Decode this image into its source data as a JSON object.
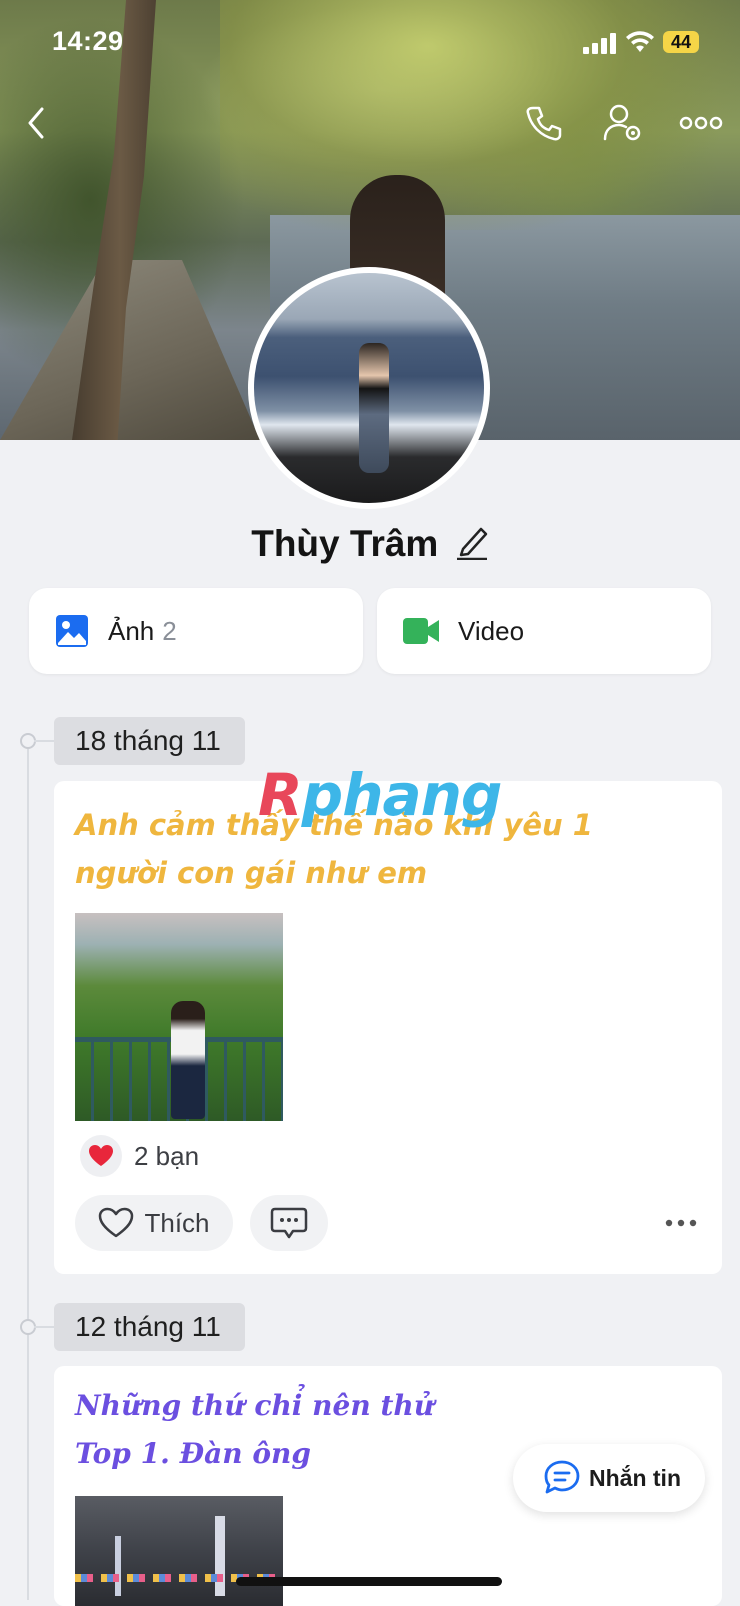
{
  "status_bar": {
    "time": "14:29",
    "battery": "44"
  },
  "profile": {
    "name": "Thùy Trâm"
  },
  "media_buttons": {
    "photos_label": "Ảnh",
    "photos_count": "2",
    "video_label": "Video"
  },
  "watermark": {
    "part1": "R",
    "part2": "phang"
  },
  "posts": [
    {
      "date": "18 tháng 11",
      "title_line1": "Anh cảm thấy thế nào khi yêu 1",
      "title_line2": "người con gái như em",
      "reactions": "2 bạn",
      "like_label": "Thích"
    },
    {
      "date": "12 tháng 11",
      "title_line1": "Những thứ chỉ nên thử",
      "title_line2": "Top 1. Đàn ông"
    }
  ],
  "message_button": {
    "label": "Nhắn tin"
  },
  "colors": {
    "accent_blue": "#1b6cf0",
    "video_green": "#34b25a",
    "post1_text": "#efb63e",
    "post2_text": "#6b4fe0",
    "heart_red": "#e8263b"
  },
  "icons": [
    "back-icon",
    "phone-icon",
    "user-settings-icon",
    "more-icon",
    "edit-icon",
    "image-icon",
    "video-camera-icon",
    "heart-icon",
    "comment-icon",
    "chat-icon"
  ]
}
